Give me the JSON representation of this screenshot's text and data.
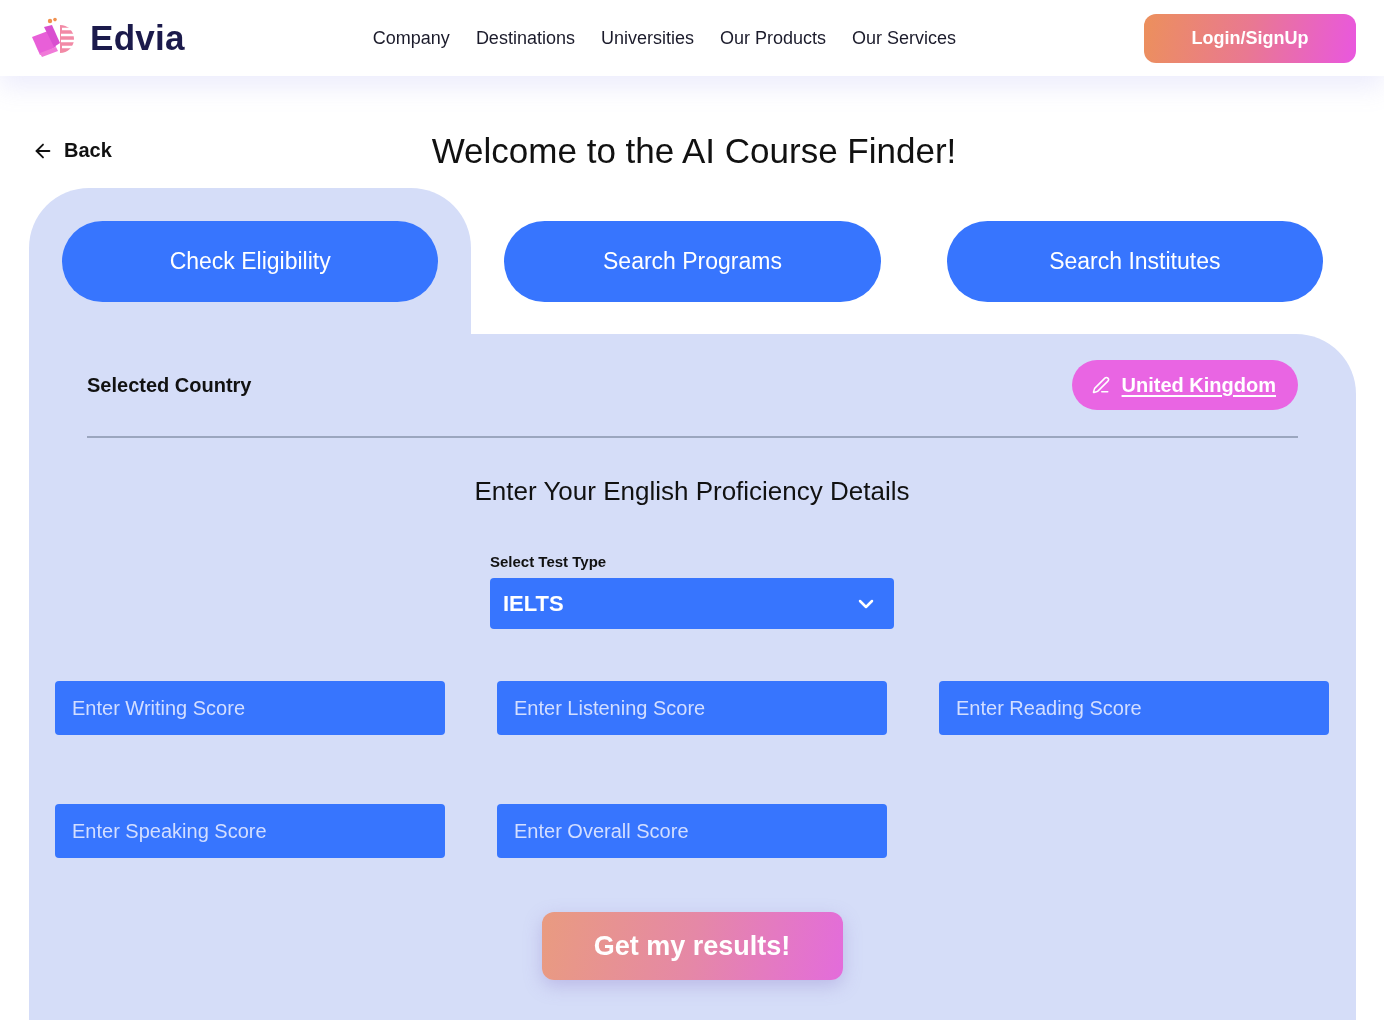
{
  "header": {
    "brand": "Edvia",
    "nav": [
      "Company",
      "Destinations",
      "Universities",
      "Our Products",
      "Our Services"
    ],
    "login_button": "Login/SignUp"
  },
  "back_link": "Back",
  "title": "Welcome to the AI Course Finder!",
  "tabs": [
    {
      "label": "Check Eligibility",
      "selected": true
    },
    {
      "label": "Search Programs",
      "selected": false
    },
    {
      "label": "Search Institutes",
      "selected": false
    }
  ],
  "selected_country": {
    "label": "Selected Country",
    "value": "United Kingdom"
  },
  "proficiency": {
    "heading": "Enter Your English Proficiency Details",
    "test_type": {
      "label": "Select Test Type",
      "value": "IELTS"
    },
    "score_fields": [
      {
        "placeholder": "Enter Writing Score"
      },
      {
        "placeholder": "Enter Listening Score"
      },
      {
        "placeholder": "Enter Reading Score"
      },
      {
        "placeholder": "Enter Speaking Score"
      },
      {
        "placeholder": "Enter Overall Score"
      }
    ]
  },
  "submit_button": "Get my results!"
}
